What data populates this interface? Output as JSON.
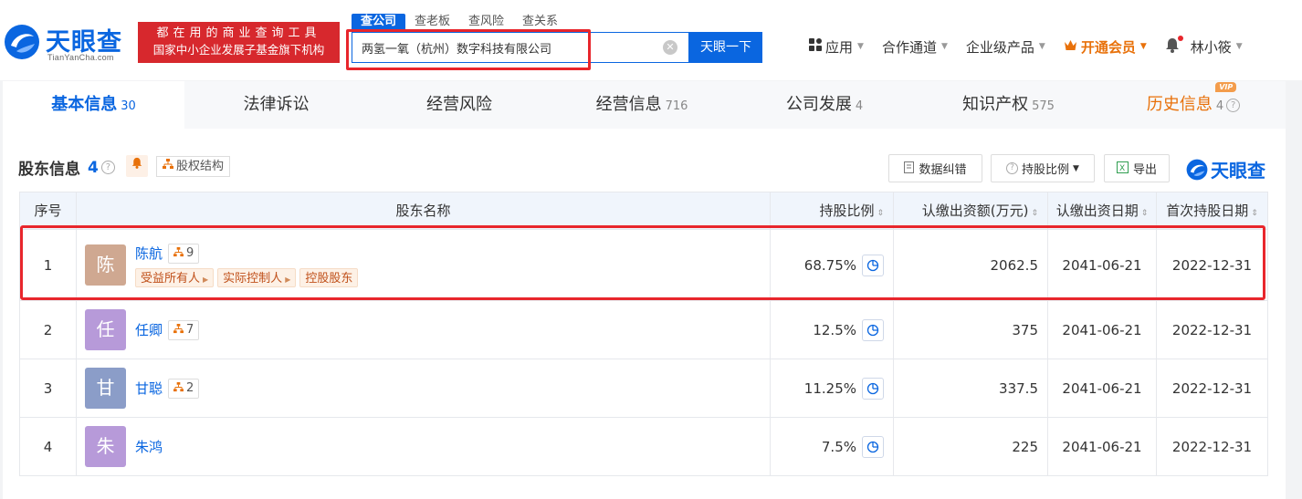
{
  "header": {
    "logo_text": "天眼查",
    "logo_url": "TianYanCha.com",
    "banner_line1": "都在用的商业查询工具",
    "banner_line2": "国家中小企业发展子基金旗下机构",
    "search_tabs": [
      "查公司",
      "查老板",
      "查风险",
      "查关系"
    ],
    "search_value": "两氢一氧（杭州）数字科技有限公司",
    "search_button": "天眼一下",
    "nav": {
      "apps": "应用",
      "cooperation": "合作通道",
      "enterprise": "企业级产品",
      "vip": "开通会员",
      "user": "林小筱"
    }
  },
  "tabs": [
    {
      "label": "基本信息",
      "count": "30"
    },
    {
      "label": "法律诉讼",
      "count": ""
    },
    {
      "label": "经营风险",
      "count": ""
    },
    {
      "label": "经营信息",
      "count": "716"
    },
    {
      "label": "公司发展",
      "count": "4"
    },
    {
      "label": "知识产权",
      "count": "575"
    },
    {
      "label": "历史信息",
      "count": "4",
      "badge": "VIP"
    }
  ],
  "section": {
    "title": "股东信息",
    "count": "4",
    "equity_structure": "股权结构",
    "correction": "数据纠错",
    "ratio_filter": "持股比例",
    "export": "导出",
    "brand": "天眼查"
  },
  "table": {
    "headers": {
      "index": "序号",
      "name": "股东名称",
      "ratio": "持股比例",
      "capital": "认缴出资额(万元)",
      "capital_date": "认缴出资日期",
      "first_date": "首次持股日期"
    },
    "rows": [
      {
        "index": "1",
        "avatar": "陈",
        "avatar_color": "#cfa891",
        "name": "陈航",
        "relations": "9",
        "tags": [
          "受益所有人",
          "实际控制人",
          "控股股东"
        ],
        "ratio": "68.75%",
        "capital": "2062.5",
        "capital_date": "2041-06-21",
        "first_date": "2022-12-31"
      },
      {
        "index": "2",
        "avatar": "任",
        "avatar_color": "#b79ad9",
        "name": "任卿",
        "relations": "7",
        "tags": [],
        "ratio": "12.5%",
        "capital": "375",
        "capital_date": "2041-06-21",
        "first_date": "2022-12-31"
      },
      {
        "index": "3",
        "avatar": "甘",
        "avatar_color": "#8b9dc8",
        "name": "甘聪",
        "relations": "2",
        "tags": [],
        "ratio": "11.25%",
        "capital": "337.5",
        "capital_date": "2041-06-21",
        "first_date": "2022-12-31"
      },
      {
        "index": "4",
        "avatar": "朱",
        "avatar_color": "#b79ad9",
        "name": "朱鸿",
        "relations": "",
        "tags": [],
        "ratio": "7.5%",
        "capital": "225",
        "capital_date": "2041-06-21",
        "first_date": "2022-12-31"
      }
    ]
  },
  "colors": {
    "brand_blue": "#0a66e0",
    "highlight_red": "#e8262c",
    "vip_orange": "#e8710a"
  }
}
